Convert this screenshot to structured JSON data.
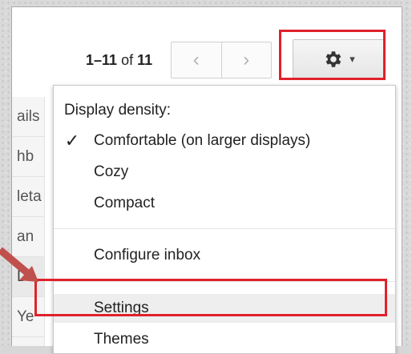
{
  "list_fragments": [
    "ails",
    "hb",
    "leta",
    "an",
    "De",
    "Ye"
  ],
  "pagination": {
    "range": "1–11",
    "of": "of",
    "total": "11"
  },
  "nav": {
    "prev_glyph": "‹",
    "next_glyph": "›"
  },
  "gear": {
    "icon": "gear-icon",
    "caret": "▾"
  },
  "menu": {
    "header": "Display density:",
    "density": [
      {
        "label": "Comfortable (on larger displays)",
        "checked": true
      },
      {
        "label": "Cozy",
        "checked": false
      },
      {
        "label": "Compact",
        "checked": false
      }
    ],
    "configure": "Configure inbox",
    "settings": "Settings",
    "themes": "Themes",
    "check_glyph": "✓"
  },
  "colors": {
    "highlight": "#e0222c",
    "arrow": "#c0504d"
  }
}
